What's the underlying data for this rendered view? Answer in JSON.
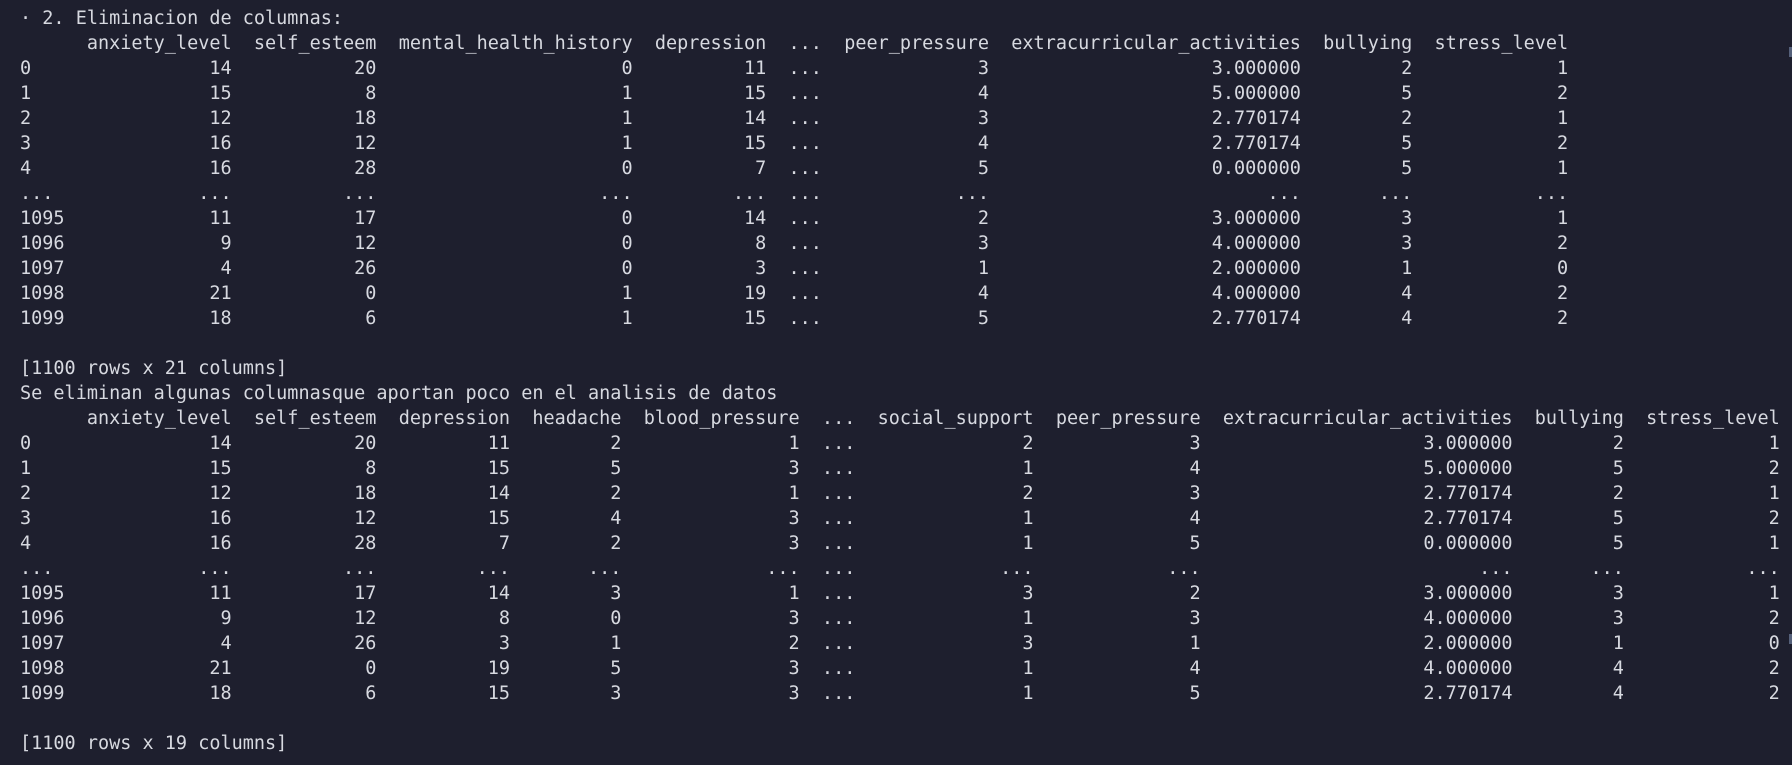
{
  "terminal": {
    "lines": [
      "· 2. Eliminacion de columnas:",
      "      anxiety_level  self_esteem  mental_health_history  depression  ...  peer_pressure  extracurricular_activities  bullying  stress_level",
      "0                14           20                      0          11  ...              3                    3.000000         2             1",
      "1                15            8                      1          15  ...              4                    5.000000         5             2",
      "2                12           18                      1          14  ...              3                    2.770174         2             1",
      "3                16           12                      1          15  ...              4                    2.770174         5             2",
      "4                16           28                      0           7  ...              5                    0.000000         5             1",
      "...             ...          ...                    ...         ...  ...            ...                         ...       ...           ...",
      "1095             11           17                      0          14  ...              2                    3.000000         3             1",
      "1096              9           12                      0           8  ...              3                    4.000000         3             2",
      "1097              4           26                      0           3  ...              1                    2.000000         1             0",
      "1098             21            0                      1          19  ...              4                    4.000000         4             2",
      "1099             18            6                      1          15  ...              5                    2.770174         4             2",
      "",
      "[1100 rows x 21 columns]",
      "Se eliminan algunas columnasque aportan poco en el analisis de datos",
      "      anxiety_level  self_esteem  depression  headache  blood_pressure  ...  social_support  peer_pressure  extracurricular_activities  bullying  stress_level",
      "0                14           20          11         2               1  ...               2              3                    3.000000         2             1",
      "1                15            8          15         5               3  ...               1              4                    5.000000         5             2",
      "2                12           18          14         2               1  ...               2              3                    2.770174         2             1",
      "3                16           12          15         4               3  ...               1              4                    2.770174         5             2",
      "4                16           28           7         2               3  ...               1              5                    0.000000         5             1",
      "...             ...          ...         ...       ...             ...  ...             ...            ...                         ...       ...           ...",
      "1095             11           17          14         3               1  ...               3              2                    3.000000         3             1",
      "1096              9           12           8         0               3  ...               1              3                    4.000000         3             2",
      "1097              4           26           3         1               2  ...               3              1                    2.000000         1             0",
      "1098             21            0          19         5               3  ...               1              4                    4.000000         4             2",
      "1099             18            6          15         3               3  ...               1              5                    2.770174         4             2",
      "",
      "[1100 rows x 19 columns]"
    ]
  },
  "colors": {
    "background": "#1e1f2e",
    "text": "#d7d9e0",
    "scroll_marker": "#55607a"
  }
}
